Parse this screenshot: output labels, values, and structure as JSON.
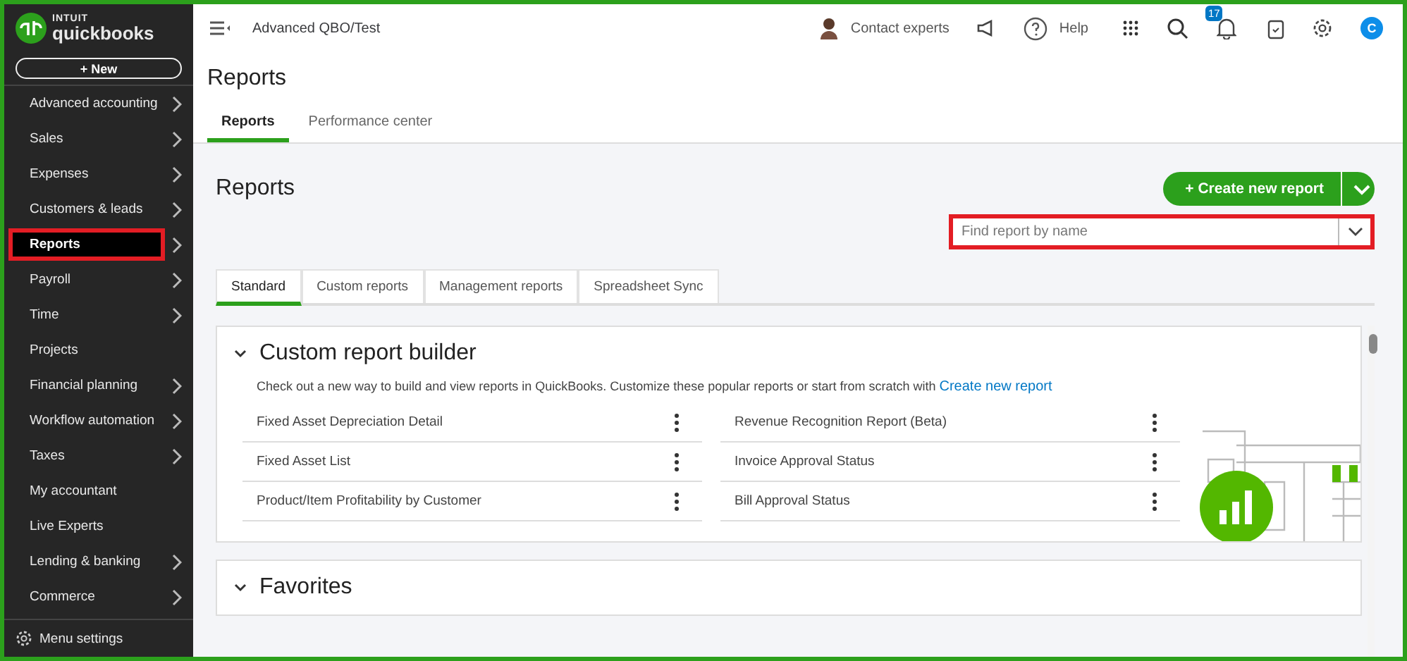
{
  "sidebar": {
    "brand_top": "INTUIT",
    "brand": "quickbooks",
    "new_button": "+ New",
    "items": [
      {
        "label": "Advanced accounting",
        "selected": false,
        "has_submenu": true,
        "highlighted": false
      },
      {
        "label": "Sales",
        "selected": false,
        "has_submenu": true,
        "highlighted": false
      },
      {
        "label": "Expenses",
        "selected": false,
        "has_submenu": true,
        "highlighted": false
      },
      {
        "label": "Customers & leads",
        "selected": false,
        "has_submenu": true,
        "highlighted": false
      },
      {
        "label": "Reports",
        "selected": true,
        "has_submenu": true,
        "highlighted": true
      },
      {
        "label": "Payroll",
        "selected": false,
        "has_submenu": true,
        "highlighted": false
      },
      {
        "label": "Time",
        "selected": false,
        "has_submenu": true,
        "highlighted": false
      },
      {
        "label": "Projects",
        "selected": false,
        "has_submenu": false,
        "highlighted": false
      },
      {
        "label": "Financial planning",
        "selected": false,
        "has_submenu": true,
        "highlighted": false
      },
      {
        "label": "Workflow automation",
        "selected": false,
        "has_submenu": true,
        "highlighted": false
      },
      {
        "label": "Taxes",
        "selected": false,
        "has_submenu": true,
        "highlighted": false
      },
      {
        "label": "My accountant",
        "selected": false,
        "has_submenu": false,
        "highlighted": false
      },
      {
        "label": "Live Experts",
        "selected": false,
        "has_submenu": false,
        "highlighted": false
      },
      {
        "label": "Lending & banking",
        "selected": false,
        "has_submenu": true,
        "highlighted": false
      },
      {
        "label": "Commerce",
        "selected": false,
        "has_submenu": true,
        "highlighted": false
      }
    ],
    "menu_settings": "Menu settings"
  },
  "topbar": {
    "company": "Advanced QBO/Test",
    "contact": "Contact experts",
    "help": "Help",
    "notification_count": "17",
    "avatar_letter": "C"
  },
  "page": {
    "title": "Reports",
    "tabs": [
      {
        "label": "Reports",
        "selected": true
      },
      {
        "label": "Performance center",
        "selected": false
      }
    ]
  },
  "reports": {
    "heading": "Reports",
    "create_button": "+ Create new report",
    "search": {
      "placeholder": "Find report by name",
      "highlighted": true
    },
    "tabs": [
      {
        "label": "Standard",
        "selected": true
      },
      {
        "label": "Custom reports",
        "selected": false
      },
      {
        "label": "Management reports",
        "selected": false
      },
      {
        "label": "Spreadsheet Sync",
        "selected": false
      }
    ],
    "sections": [
      {
        "title": "Custom report builder",
        "expanded": true,
        "description": "Check out a new way to build and view reports in QuickBooks. Customize these popular reports or start from scratch with",
        "link": "Create new report",
        "items": [
          "Fixed Asset Depreciation Detail",
          "Revenue Recognition Report (Beta)",
          "Fixed Asset List",
          "Invoice Approval Status",
          "Product/Item Profitability by Customer",
          "Bill Approval Status"
        ]
      },
      {
        "title": "Favorites",
        "expanded": true
      }
    ]
  }
}
